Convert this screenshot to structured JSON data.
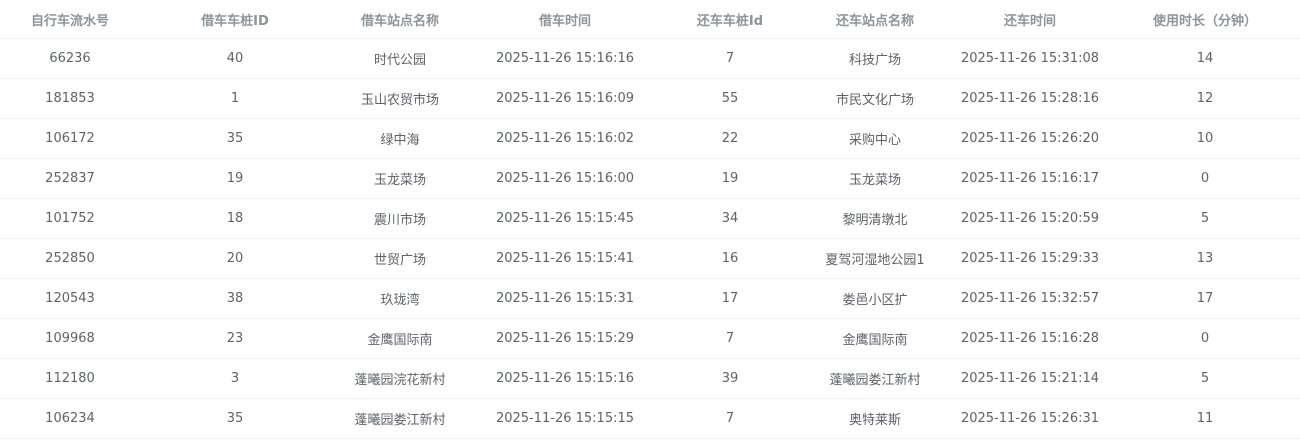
{
  "table": {
    "columns": [
      "自行车流水号",
      "借车车桩ID",
      "借车站点名称",
      "借车时间",
      "还车车桩Id",
      "还车站点名称",
      "还车时间",
      "使用时长（分钟）"
    ],
    "rows": [
      [
        "66236",
        "40",
        "时代公园",
        "2025-11-26 15:16:16",
        "7",
        "科技广场",
        "2025-11-26 15:31:08",
        "14"
      ],
      [
        "181853",
        "1",
        "玉山农贸市场",
        "2025-11-26 15:16:09",
        "55",
        "市民文化广场",
        "2025-11-26 15:28:16",
        "12"
      ],
      [
        "106172",
        "35",
        "绿中海",
        "2025-11-26 15:16:02",
        "22",
        "采购中心",
        "2025-11-26 15:26:20",
        "10"
      ],
      [
        "252837",
        "19",
        "玉龙菜场",
        "2025-11-26 15:16:00",
        "19",
        "玉龙菜场",
        "2025-11-26 15:16:17",
        "0"
      ],
      [
        "101752",
        "18",
        "震川市场",
        "2025-11-26 15:15:45",
        "34",
        "黎明清墩北",
        "2025-11-26 15:20:59",
        "5"
      ],
      [
        "252850",
        "20",
        "世贸广场",
        "2025-11-26 15:15:41",
        "16",
        "夏驾河湿地公园1",
        "2025-11-26 15:29:33",
        "13"
      ],
      [
        "120543",
        "38",
        "玖珑湾",
        "2025-11-26 15:15:31",
        "17",
        "娄邑小区扩",
        "2025-11-26 15:32:57",
        "17"
      ],
      [
        "109968",
        "23",
        "金鹰国际南",
        "2025-11-26 15:15:29",
        "7",
        "金鹰国际南",
        "2025-11-26 15:16:28",
        "0"
      ],
      [
        "112180",
        "3",
        "蓬曦园浣花新村",
        "2025-11-26 15:15:16",
        "39",
        "蓬曦园娄江新村",
        "2025-11-26 15:21:14",
        "5"
      ],
      [
        "106234",
        "35",
        "蓬曦园娄江新村",
        "2025-11-26 15:15:15",
        "7",
        "奥特莱斯",
        "2025-11-26 15:26:31",
        "11"
      ]
    ]
  }
}
